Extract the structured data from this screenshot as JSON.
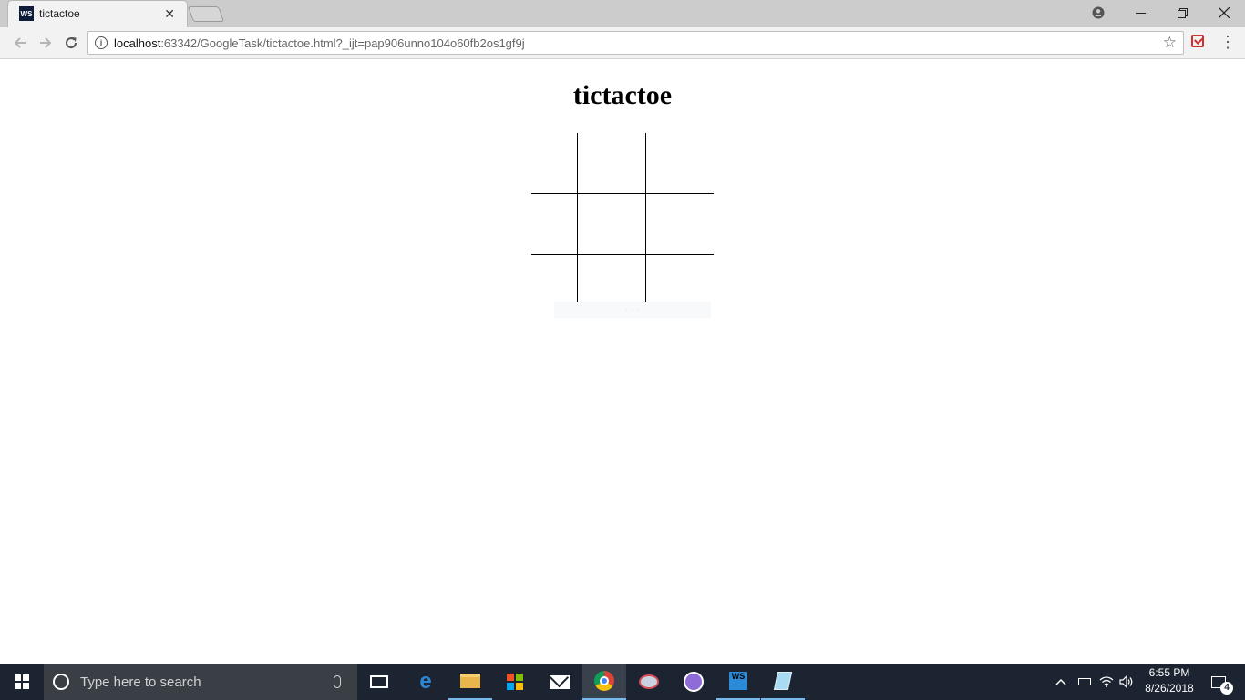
{
  "browser": {
    "tab_title": "tictactoe",
    "favicon_text": "WS",
    "tab_close_glyph": "✕",
    "url_host": "localhost",
    "url_rest": ":63342/GoogleTask/tictactoe.html?_ijt=pap906unno104o60fb2os1gf9j",
    "icons": {
      "back": "arrow-left-icon",
      "forward": "arrow-right-icon",
      "reload": "reload-icon",
      "site_info": "info-icon",
      "bookmark": "star-icon",
      "extension": "pocket-extension-icon",
      "menu": "kebab-menu-icon",
      "profile": "profile-icon"
    }
  },
  "page": {
    "title": "tictactoe",
    "board": {
      "rows": 3,
      "cols": 3,
      "cells": [
        "",
        "",
        "",
        "",
        "",
        "",
        "",
        "",
        ""
      ]
    },
    "faint_text": "· · ·"
  },
  "taskbar": {
    "search_placeholder": "Type here to search",
    "apps": [
      "task-view",
      "edge",
      "file-explorer",
      "store",
      "mail",
      "chrome",
      "paint",
      "gitkraken",
      "webstorm",
      "notepad"
    ],
    "active_app": "chrome",
    "clock_time": "6:55 PM",
    "clock_date": "8/26/2018",
    "notification_count": "4"
  },
  "colors": {
    "titlebar": "#cccccc",
    "taskbar": "#1b2430",
    "accent": "#76b9ed"
  }
}
